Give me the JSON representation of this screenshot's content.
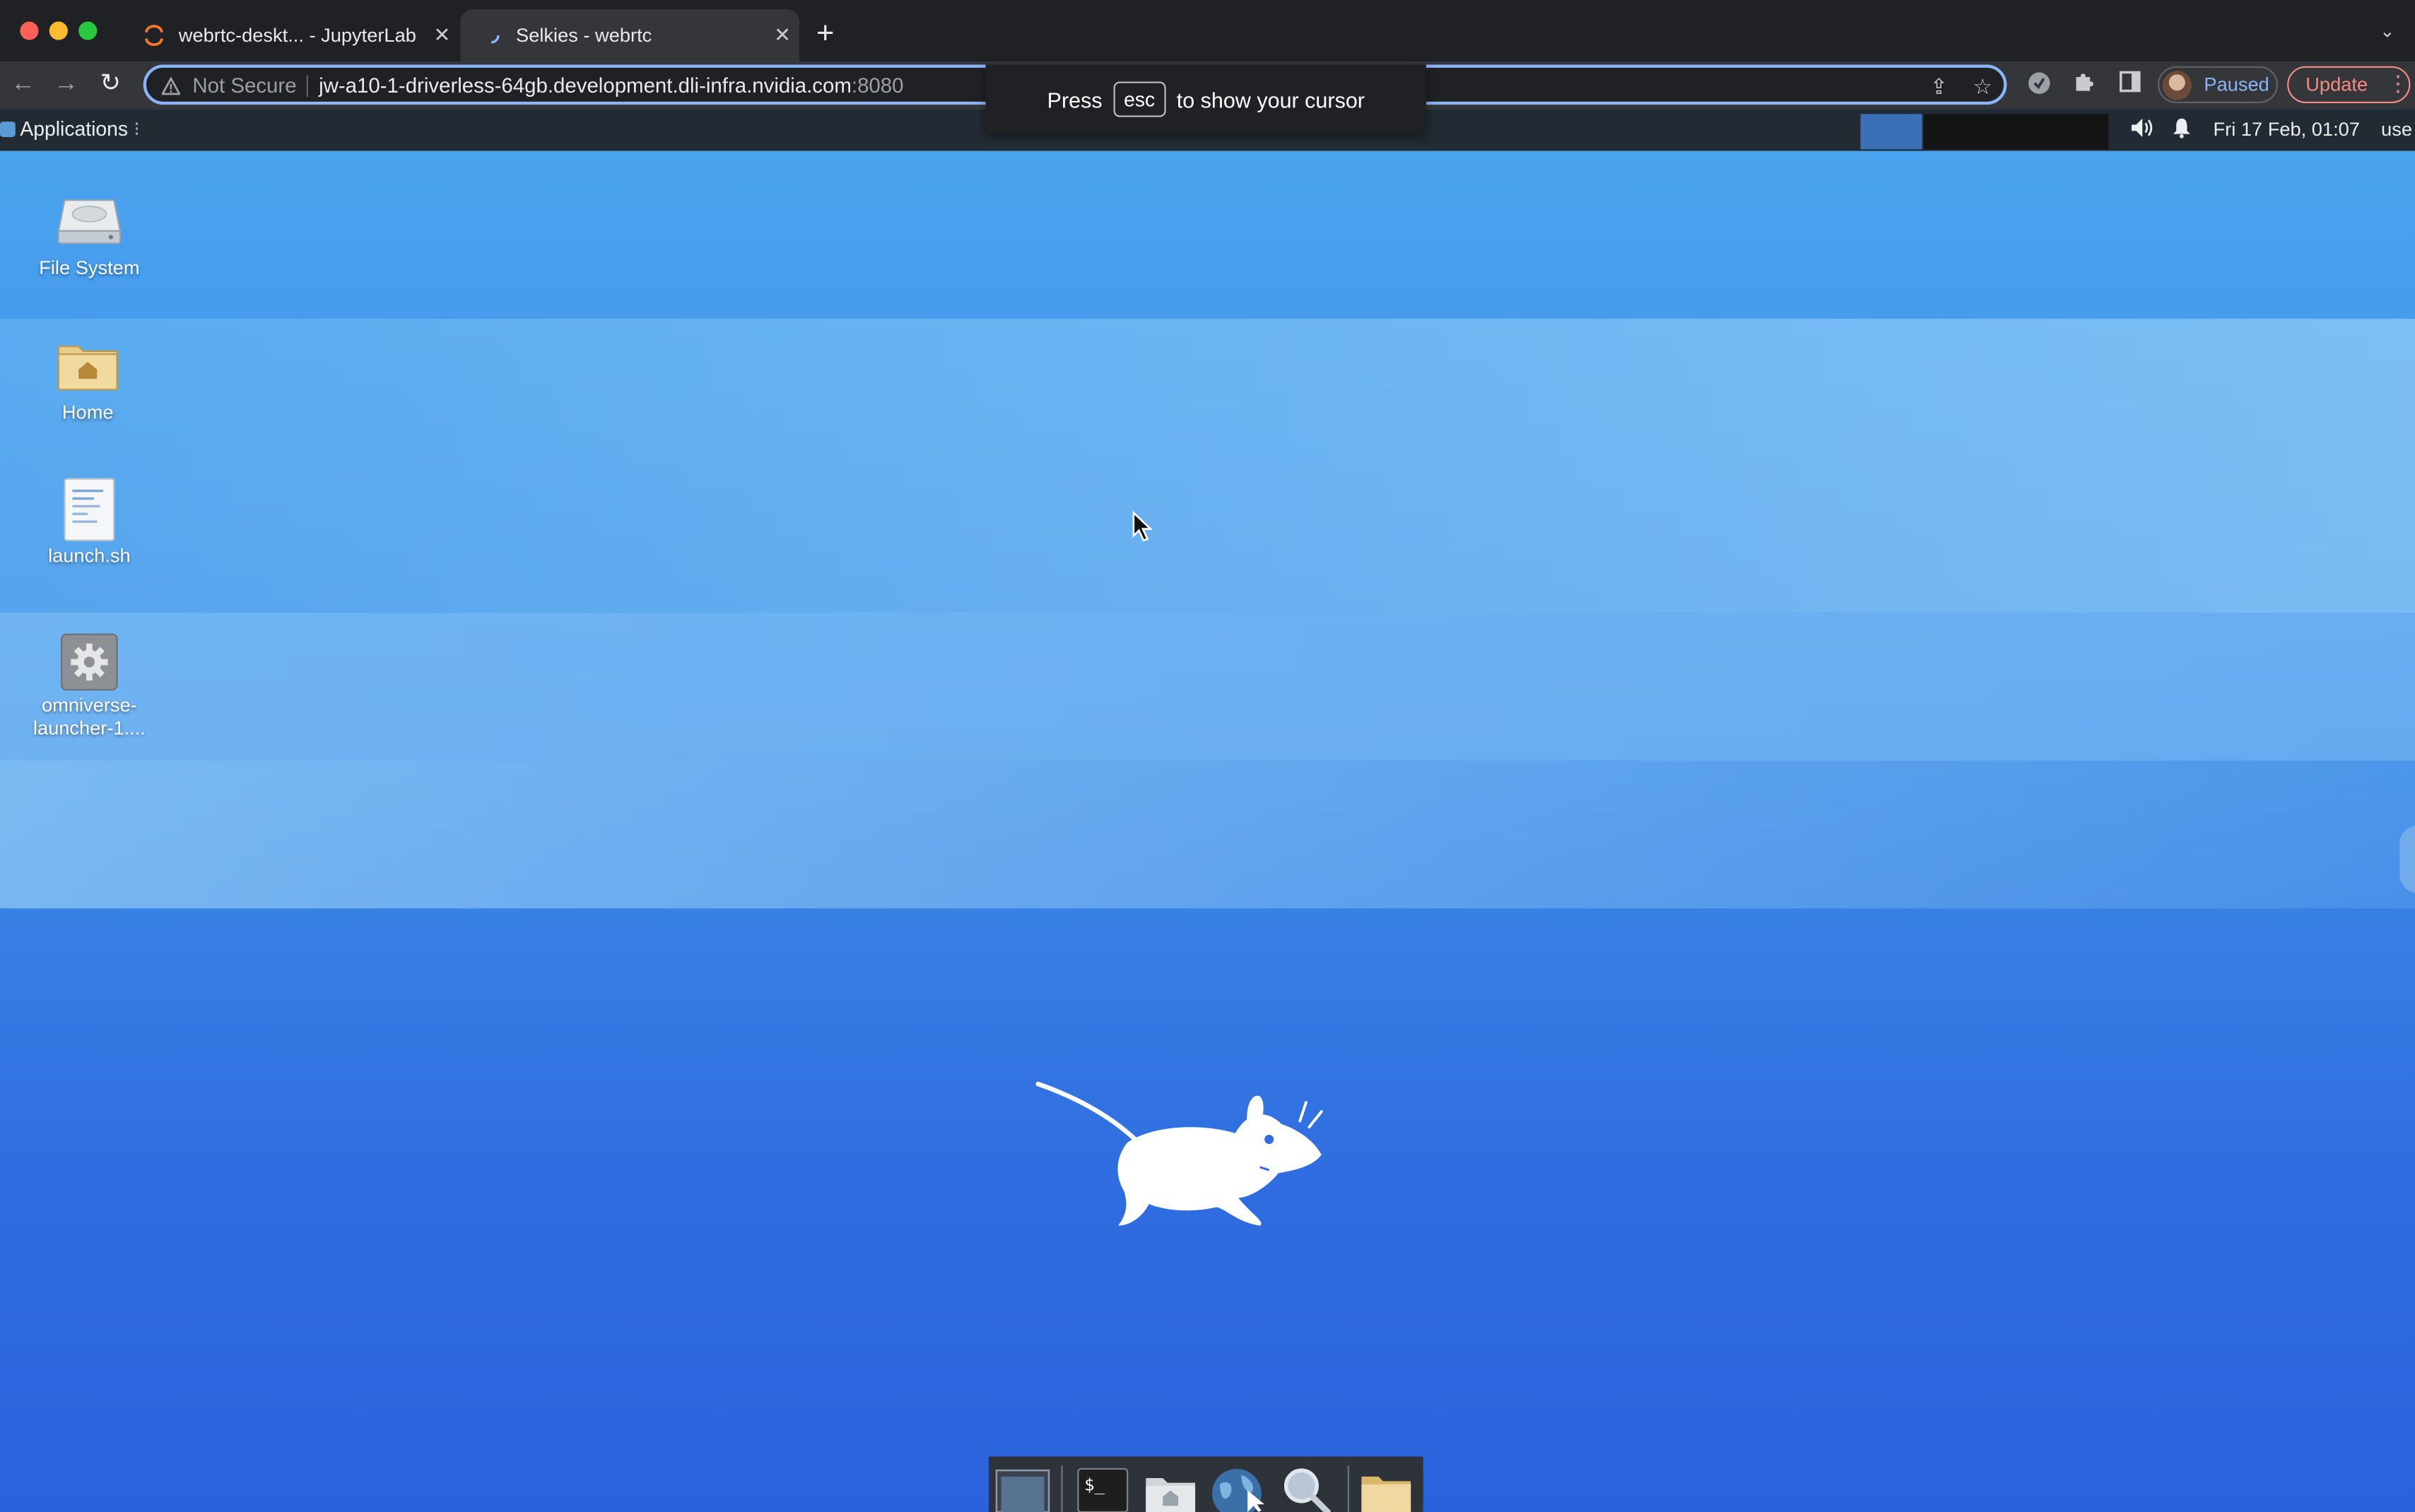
{
  "browser": {
    "tabs": [
      {
        "title": "webrtc-deskt... - JupyterLab",
        "active": false
      },
      {
        "title": "Selkies - webrtc",
        "active": true
      }
    ],
    "new_tab_label": "+",
    "address": {
      "security": "Not Secure",
      "host": "jw-a10-1-driverless-64gb.development.dli-infra.nvidia.com",
      "port": ":8080"
    },
    "profile_label": "Paused",
    "update_label": "Update"
  },
  "toast": {
    "prefix": "Press",
    "key": "esc",
    "suffix": "to show your cursor"
  },
  "panel": {
    "applications_label": "Applications",
    "clock": "Fri 17 Feb, 01:07",
    "user_label": "use"
  },
  "desktop": {
    "icons": [
      {
        "label": "File System",
        "icon": "hard-drive-icon"
      },
      {
        "label": "Home",
        "icon": "home-folder-icon"
      },
      {
        "label": "launch.sh",
        "icon": "text-file-icon"
      },
      {
        "label_line1": "omniverse-",
        "label_line2": "launcher-1....",
        "icon": "gear-icon"
      }
    ]
  },
  "colors": {
    "desktop_top": "#4aa3ef",
    "desktop_bottom": "#2a62dc",
    "accent": "#8ab4f8",
    "update": "#f28b82"
  }
}
